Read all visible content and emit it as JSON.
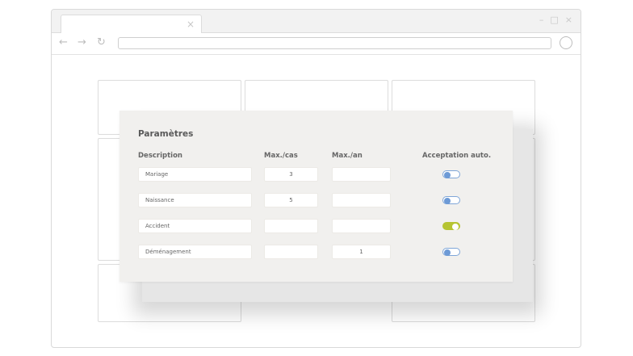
{
  "window": {
    "tab_close_glyph": "×",
    "minimize_glyph": "–",
    "maximize_glyph": "□",
    "close_glyph": "×",
    "back_glyph": "←",
    "forward_glyph": "→",
    "reload_glyph": "↻",
    "address_value": ""
  },
  "dialog": {
    "title": "Paramètres",
    "columns": {
      "description": "Description",
      "max_case": "Max./cas",
      "max_year": "Max./an",
      "auto_accept": "Acceptation auto."
    },
    "rows": [
      {
        "description": "Mariage",
        "max_case": "3",
        "max_year": "",
        "auto_accept": false
      },
      {
        "description": "Naissance",
        "max_case": "5",
        "max_year": "",
        "auto_accept": false
      },
      {
        "description": "Accident",
        "max_case": "",
        "max_year": "",
        "auto_accept": true
      },
      {
        "description": "Déménagement",
        "max_case": "",
        "max_year": "1",
        "auto_accept": false
      }
    ]
  },
  "colors": {
    "toggle_off_knob": "#6d9ad6",
    "toggle_on_track": "#b6c432",
    "dialog_bg": "#f1f0ee"
  }
}
